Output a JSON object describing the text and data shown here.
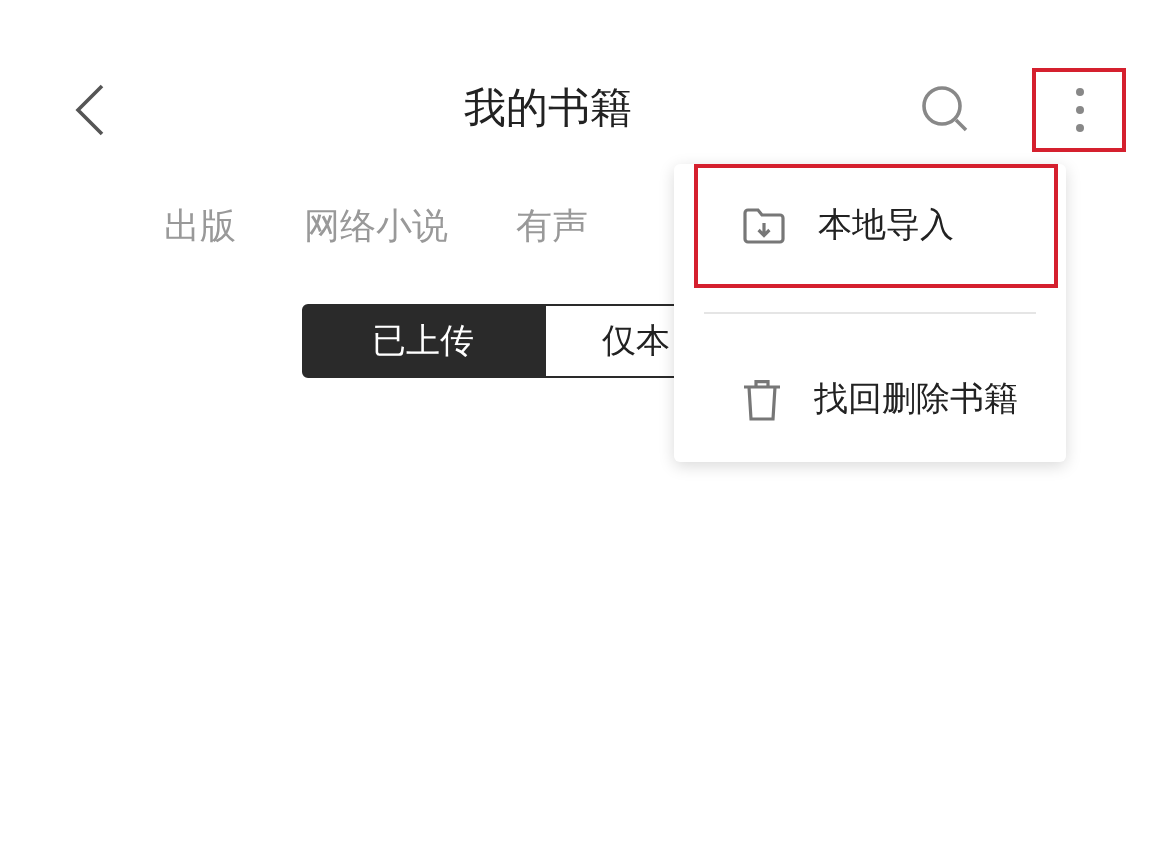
{
  "header": {
    "title": "我的书籍",
    "more_highlighted": true
  },
  "tabs": [
    {
      "label": "出版",
      "selected": false
    },
    {
      "label": "网络小说",
      "selected": false
    },
    {
      "label": "有声",
      "selected": false
    }
  ],
  "segments": [
    {
      "label": "已上传",
      "selected": true
    },
    {
      "label": "仅本",
      "selected": false
    }
  ],
  "menu": [
    {
      "kind": "import",
      "label": "本地导入",
      "highlighted": true
    },
    {
      "kind": "trash",
      "label": "找回删除书籍",
      "highlighted": false
    }
  ]
}
